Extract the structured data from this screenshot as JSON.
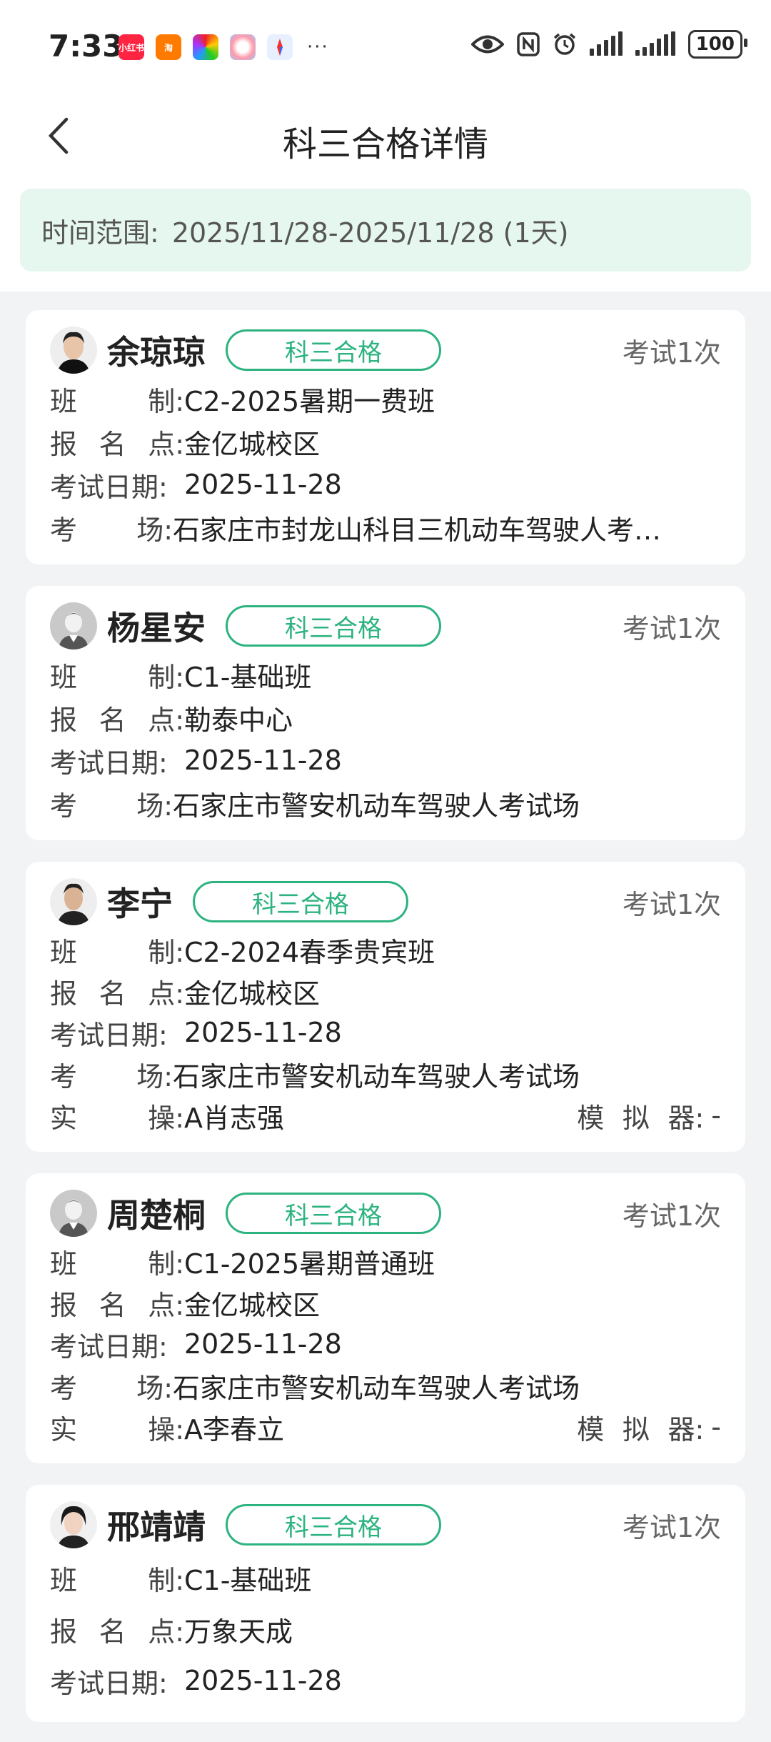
{
  "status": {
    "time": "7:33",
    "battery": "100",
    "notif_icons": [
      "xiaohongshu-icon",
      "taobao-icon",
      "app-icon",
      "circle-icon",
      "compass-icon"
    ],
    "more": "···"
  },
  "header": {
    "title": "科三合格详情"
  },
  "range": {
    "label": "时间范围:",
    "value": "2025/11/28-2025/11/28 (1天)"
  },
  "labels": {
    "class_a": "班",
    "class_b": "制:",
    "site_a": "报",
    "site_b": "名",
    "site_c": "点:",
    "date": "考试日期:",
    "venue_a": "考",
    "venue_b": "场:",
    "op_a": "实",
    "op_b": "操:",
    "sim_a": "模",
    "sim_b": "拟",
    "sim_c": "器:"
  },
  "students": [
    {
      "name": "余琼琼",
      "badge": "科三合格",
      "count": "考试1次",
      "class": "C2-2025暑期一费班",
      "site": "金亿城校区",
      "date": "2025-11-28",
      "venue": "石家庄市封龙山科目三机动车驾驶人考…"
    },
    {
      "name": "杨星安",
      "badge": "科三合格",
      "count": "考试1次",
      "class": "C1-基础班",
      "site": "勒泰中心",
      "date": "2025-11-28",
      "venue": "石家庄市警安机动车驾驶人考试场"
    },
    {
      "name": "李宁",
      "badge": "科三合格",
      "count": "考试1次",
      "class": "C2-2024春季贵宾班",
      "site": "金亿城校区",
      "date": "2025-11-28",
      "venue": "石家庄市警安机动车驾驶人考试场",
      "operator": "A肖志强",
      "simulator": "-"
    },
    {
      "name": "周楚桐",
      "badge": "科三合格",
      "count": "考试1次",
      "class": "C1-2025暑期普通班",
      "site": "金亿城校区",
      "date": "2025-11-28",
      "venue": "石家庄市警安机动车驾驶人考试场",
      "operator": "A李春立",
      "simulator": "-"
    },
    {
      "name": "邢靖靖",
      "badge": "科三合格",
      "count": "考试1次",
      "class": "C1-基础班",
      "site": "万象天成",
      "date": "2025-11-28"
    }
  ]
}
